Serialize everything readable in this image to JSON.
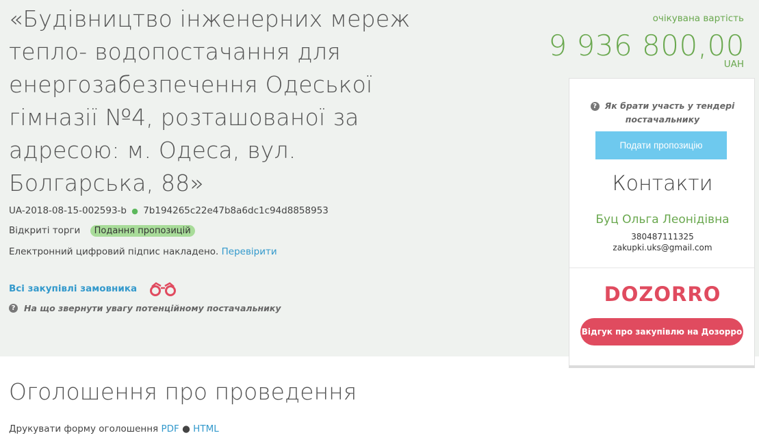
{
  "tender": {
    "title": "«Будівництво інженерних мереж тепло- водопостачання для енергозабезпечення Одеської гімназії №4, розташованої за адресою: м. Одеса, вул. Болгарська, 88»",
    "id": "UA-2018-08-15-002593-b",
    "hash": "7b194265c22e47b8a6dc1c94d8858953",
    "procedure_type": "Відкриті торги",
    "status": "Подання пропозицій",
    "signature_text": "Електронний цифровий підпис накладено.",
    "verify_link": "Перевірити",
    "all_purchases_link": "Всі закупівлі замовника",
    "attention_text": "На що звернути увагу потенційному постачальнику"
  },
  "price": {
    "label": "очікувана вартість",
    "value": "9 936 800,00",
    "currency": "UAH"
  },
  "sidebar": {
    "how_to_text": "Як брати участь у тендері постачальнику",
    "submit_button": "Подати пропозицію",
    "contacts_heading": "Контакти",
    "contact_name": "Буц Ольга Леонідівна",
    "contact_phone": "380487111325",
    "contact_email": "zakupki.uks@gmail.com",
    "dozorro_logo": "DOZORRO",
    "dozorro_button": "Відгук про закупівлю на Дозорро"
  },
  "announcement": {
    "heading": "Оголошення про проведення",
    "print_label": "Друкувати форму оголошення",
    "pdf_link": "PDF",
    "separator": "●",
    "html_link": "HTML"
  },
  "colors": {
    "accent_green": "#6aa84f",
    "link_blue": "#3399cc",
    "submit_blue": "#6ec9ee",
    "dozorro_red": "#e04b5f",
    "status_badge": "#a8dc99",
    "header_bg": "#eff2ef"
  },
  "icons": {
    "question": "question-circle-icon",
    "binoculars": "binoculars-icon",
    "status_dot": "dot-icon"
  }
}
